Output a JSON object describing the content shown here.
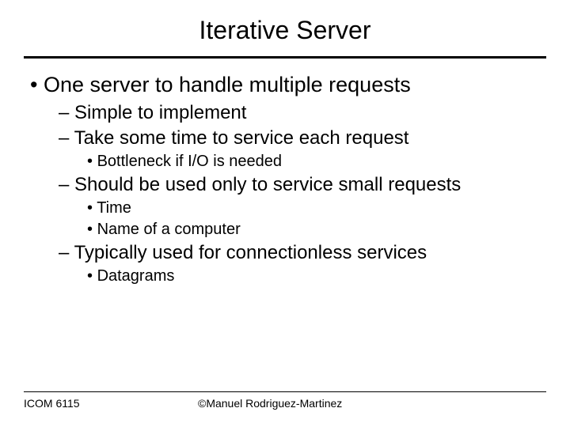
{
  "title": "Iterative Server",
  "bullets": {
    "main": "One server to handle multiple requests",
    "sub1": "Simple to implement",
    "sub2": "Take some time to service each request",
    "sub2a": "Bottleneck if I/O is needed",
    "sub3": "Should be used only to service small requests",
    "sub3a": "Time",
    "sub3b": "Name of a computer",
    "sub4": "Typically used for connectionless services",
    "sub4a": "Datagrams"
  },
  "footer": {
    "left": "ICOM 6115",
    "center": "©Manuel Rodriguez-Martinez"
  }
}
